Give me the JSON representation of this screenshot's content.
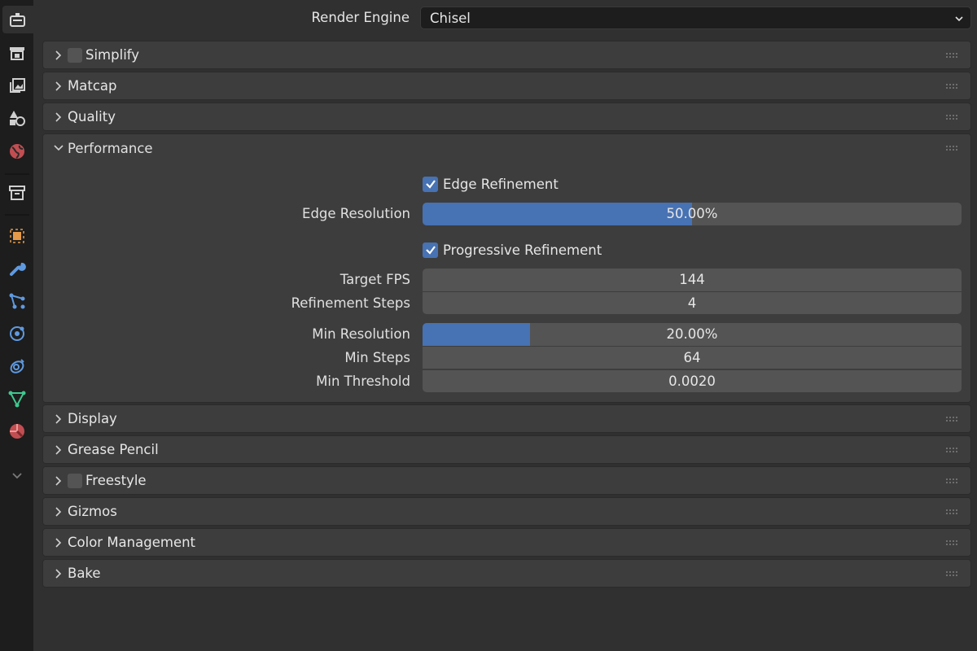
{
  "header": {
    "render_engine_label": "Render Engine",
    "render_engine_value": "Chisel"
  },
  "tabs": [
    "tool-icon",
    "render-icon",
    "output-icon",
    "view-layer-icon",
    "scene-icon",
    "world-icon",
    "collection-icon",
    "object-icon",
    "modifier-icon",
    "particles-icon",
    "physics-icon",
    "constraints-icon",
    "data-icon",
    "material-icon",
    "chevron-down-icon"
  ],
  "panels": {
    "simplify": "Simplify",
    "matcap": "Matcap",
    "quality": "Quality",
    "performance": "Performance",
    "display": "Display",
    "grease_pencil": "Grease Pencil",
    "freestyle": "Freestyle",
    "gizmos": "Gizmos",
    "color_management": "Color Management",
    "bake": "Bake"
  },
  "performance": {
    "edge_refinement": {
      "label": "Edge Refinement",
      "checked": true
    },
    "edge_resolution": {
      "label": "Edge Resolution",
      "value": "50.00%",
      "fraction": 0.5
    },
    "progressive_refinement": {
      "label": "Progressive Refinement",
      "checked": true
    },
    "target_fps": {
      "label": "Target FPS",
      "value": "144"
    },
    "refinement_steps": {
      "label": "Refinement Steps",
      "value": "4"
    },
    "min_resolution": {
      "label": "Min Resolution",
      "value": "20.00%",
      "fraction": 0.2
    },
    "min_steps": {
      "label": "Min Steps",
      "value": "64"
    },
    "min_threshold": {
      "label": "Min Threshold",
      "value": "0.0020"
    }
  },
  "colors": {
    "accent": "#4772b3",
    "panel": "#3d3d3d",
    "background": "#303030",
    "field": "#545454"
  }
}
